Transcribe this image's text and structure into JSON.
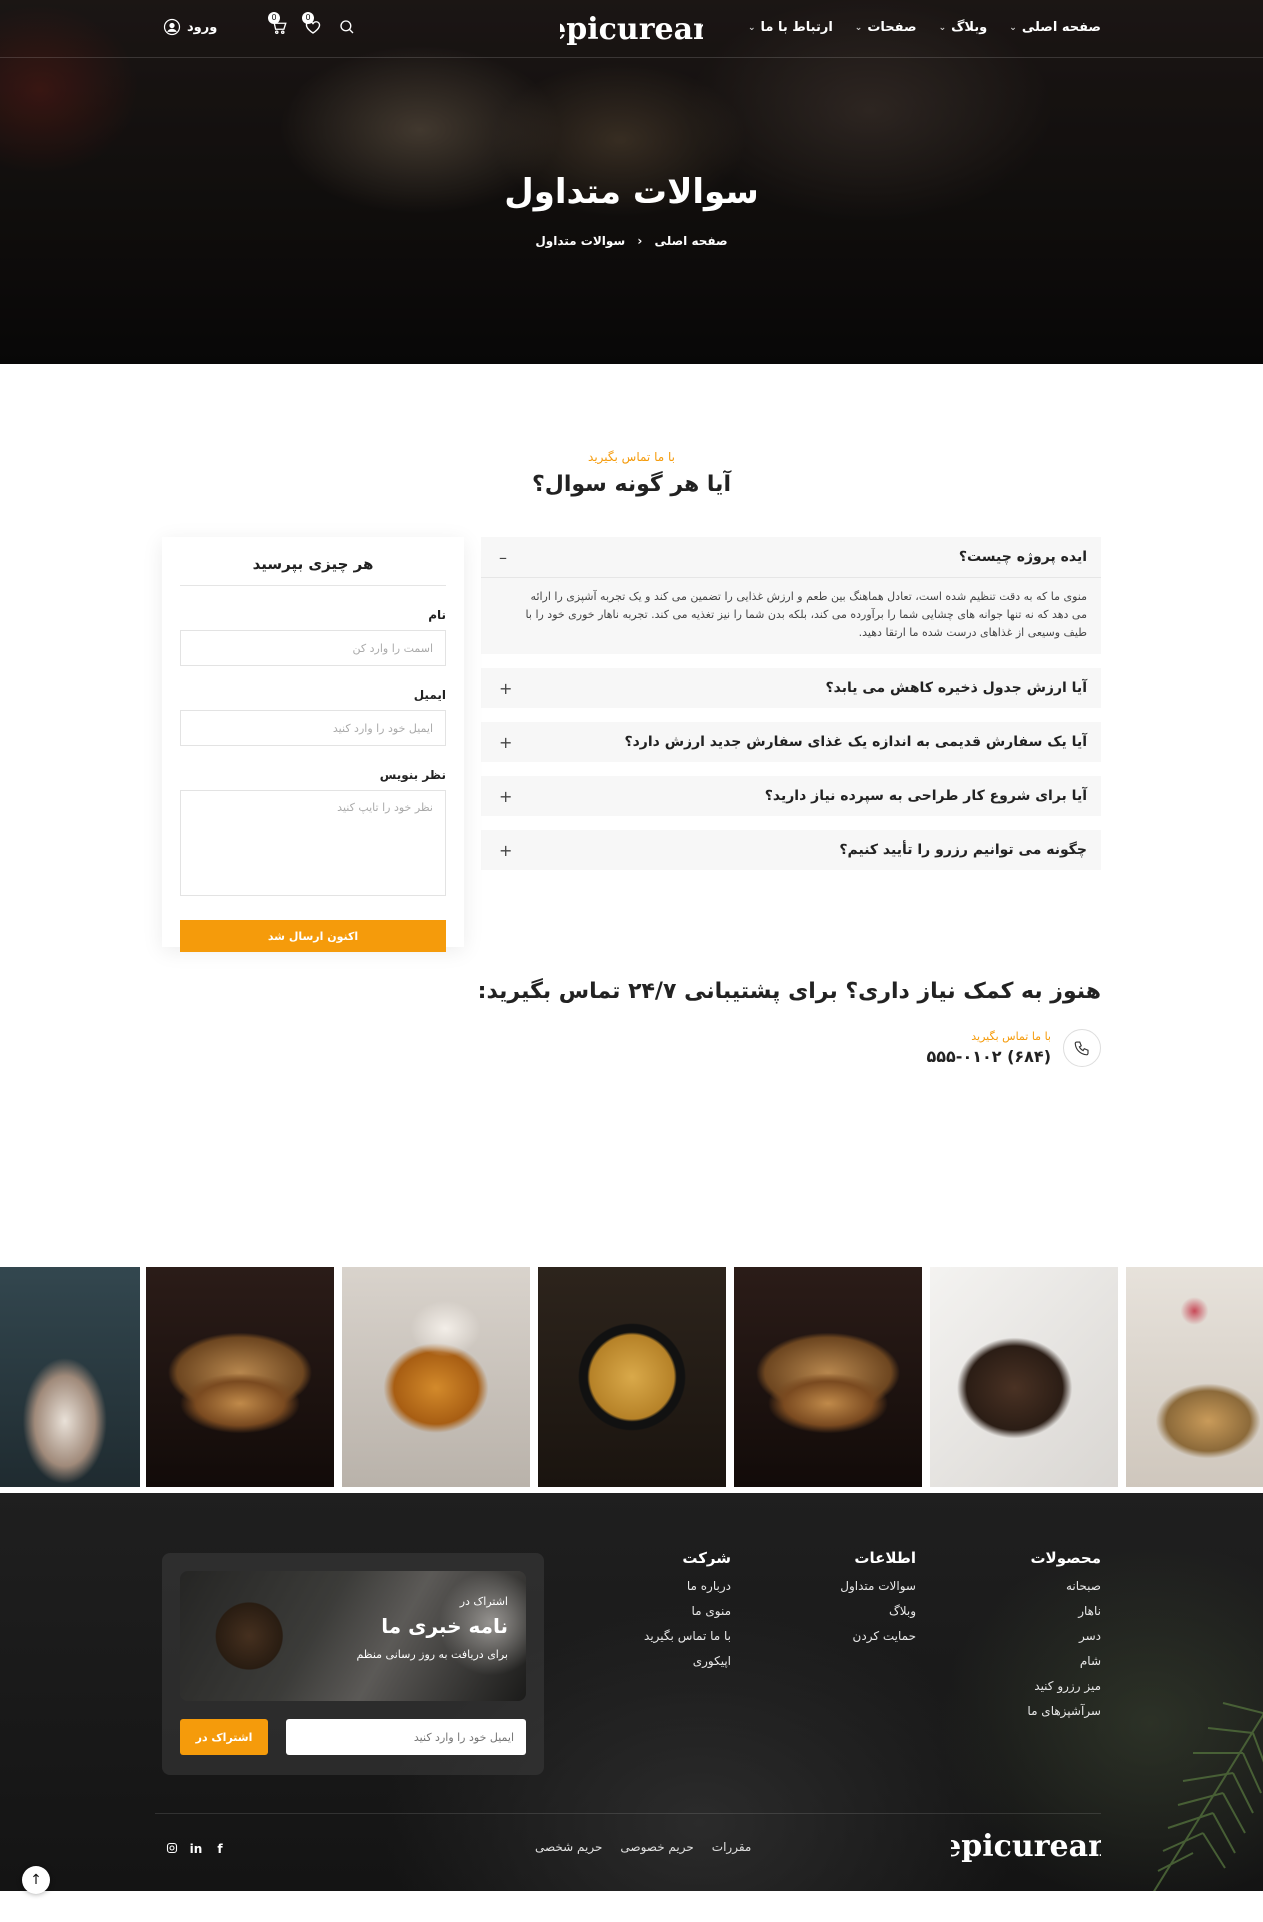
{
  "header": {
    "brand": "epicurean",
    "nav": [
      {
        "label": "صفحه اصلی"
      },
      {
        "label": "وبلاگ"
      },
      {
        "label": "صفحات"
      },
      {
        "label": "ارتباط با ما"
      }
    ],
    "wishlist_count": "0",
    "cart_count": "0",
    "login_label": "ورود"
  },
  "hero": {
    "title": "سوالات متداول",
    "breadcrumb_home": "صفحه اصلی",
    "breadcrumb_current": "سوالات متداول"
  },
  "faq": {
    "eyebrow": "با ما تماس بگیرید",
    "title": "آیا هر گونه سوال؟",
    "items": [
      {
        "q": "ایده پروژه چیست؟",
        "sign": "–",
        "open": true,
        "a": "منوی ما که به دقت تنظیم شده است، تعادل هماهنگ بین طعم و ارزش غذایی را تضمین می کند و یک تجربه آشپزی را ارائه می دهد که نه تنها جوانه های چشایی شما را برآورده می کند، بلکه بدن شما را نیز تغذیه می کند. تجربه ناهار خوری خود را با طیف وسیعی از غذاهای درست شده ما ارتقا دهید."
      },
      {
        "q": "آیا ارزش جدول ذخیره کاهش می یابد؟",
        "sign": "+"
      },
      {
        "q": "آیا یک سفارش قدیمی به اندازه یک غذای سفارش جدید ارزش دارد؟",
        "sign": "+"
      },
      {
        "q": "آیا برای شروع کار طراحی به سپرده نیاز دارید؟",
        "sign": "+"
      },
      {
        "q": "چگونه می توانیم رزرو را تأیید کنیم؟",
        "sign": "+"
      }
    ]
  },
  "ask_form": {
    "title": "هر چیزی بپرسید",
    "name_label": "نام",
    "name_placeholder": "اسمت را وارد کن",
    "email_label": "ایمیل",
    "email_placeholder": "ایمیل خود را وارد کنید",
    "comment_label": "نظر بنویس",
    "comment_placeholder": "نظر خود را تایپ کنید",
    "submit_label": "اکنون ارسال شد"
  },
  "help": {
    "title": "هنوز به کمک نیاز داری؟ برای پشتیبانی ۲۴/۷ تماس بگیرید:",
    "eyebrow": "با ما تماس بگیرید",
    "phone": "(۶۸۴) ۵۵۵-۰۱۰۲"
  },
  "footer": {
    "newsletter": {
      "small": "اشتراک در",
      "big": "نامه خبری ما",
      "sub": "برای دریافت به روز رسانی منظم",
      "email_placeholder": "ایمیل خود را وارد کنید",
      "button_label": "اشتراک در"
    },
    "products": {
      "title": "محصولات",
      "links": [
        "صبحانه",
        "ناهار",
        "دسر",
        "شام",
        "میز رزرو کنید",
        "سرآشپزهای ما"
      ]
    },
    "info": {
      "title": "اطلاعات",
      "links": [
        "سوالات متداول",
        "وبلاگ",
        "حمایت کردن"
      ]
    },
    "company": {
      "title": "شرکت",
      "links": [
        "درباره ما",
        "منوی ما",
        "با ما تماس بگیرید",
        "اپیکوری"
      ]
    },
    "bottom_links": [
      "مقررات",
      "حریم خصوصی",
      "حریم شخصی"
    ],
    "brand": "epicurean",
    "socials": [
      "f",
      "in",
      "ig"
    ]
  },
  "colors": {
    "accent": "#f59b0b",
    "dark": "#1a1a1a"
  }
}
